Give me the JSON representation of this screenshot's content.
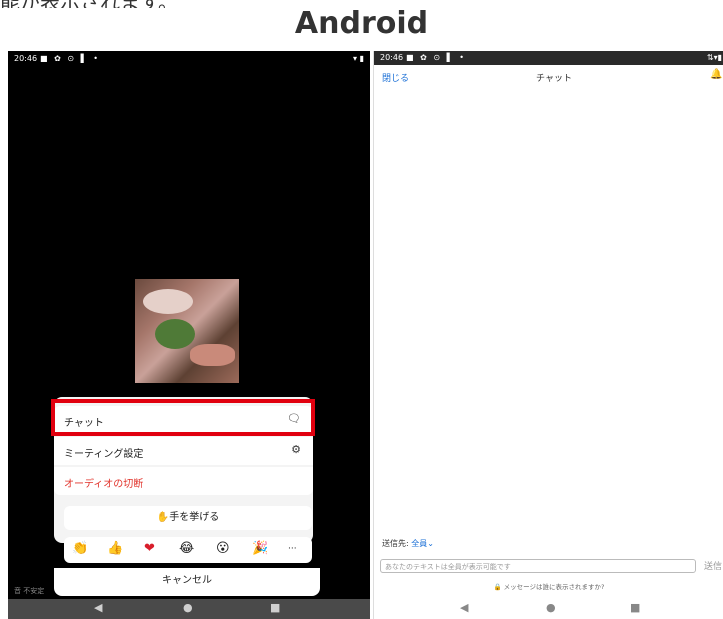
{
  "page": {
    "top_caption_cut": "能が表示されます。",
    "heading": "Android"
  },
  "left_phone": {
    "status": {
      "time": "20:46",
      "icons": "■ ✿ ⊙ ▌ •",
      "right": "▾ ▮"
    },
    "menu": {
      "chat": "チャット",
      "meeting_settings": "ミーティング設定",
      "audio_disconnect": "オーディオの切断"
    },
    "raise_hand": "✋手を挙げる",
    "reactions": [
      "👏",
      "👍",
      "❤",
      "😂",
      "😮",
      "🎉",
      "···"
    ],
    "cancel": "キャンセル",
    "corner_mark": "音 不安定",
    "nav": [
      "◀",
      "●",
      "■"
    ]
  },
  "right_phone": {
    "status": {
      "time": "20:46",
      "icons": "■ ✿ ⊙ ▌ •",
      "right": "⇅▾▮"
    },
    "close": "閉じる",
    "title": "チャット",
    "send_to_label": "送信先:",
    "send_to_target": "全員⌄",
    "input_placeholder": "あなたのテキストは全員が表示可能です",
    "send": "送信",
    "note": "🔒 メッセージは誰に表示されますか?",
    "nav": [
      "◀",
      "●",
      "■"
    ]
  },
  "colors": {
    "highlight": "#e1000f",
    "link_blue": "#1a6fd6",
    "audio_red": "#e1322a"
  }
}
